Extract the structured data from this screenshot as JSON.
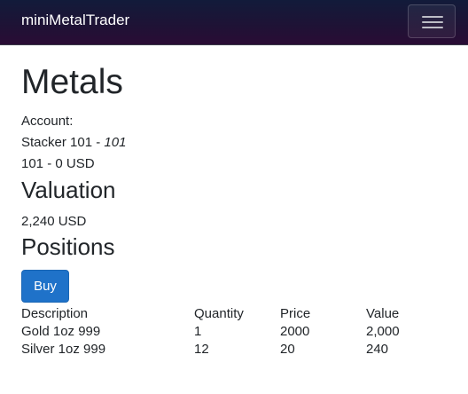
{
  "navbar": {
    "brand": "miniMetalTrader",
    "toggler_icon": "hamburger-menu-icon"
  },
  "page": {
    "title": "Metals"
  },
  "account": {
    "label": "Account:",
    "name": "Stacker 101",
    "separator": " - ",
    "number": "101",
    "balance_line": "101 - 0 USD"
  },
  "valuation": {
    "heading": "Valuation",
    "amount": "2,240 USD"
  },
  "positions": {
    "heading": "Positions",
    "buy_label": "Buy",
    "columns": [
      "Description",
      "Quantity",
      "Price",
      "Value"
    ],
    "rows": [
      {
        "description": "Gold 1oz 999",
        "quantity": "1",
        "price": "2000",
        "value": "2,000"
      },
      {
        "description": "Silver 1oz 999",
        "quantity": "12",
        "price": "20",
        "value": "240"
      }
    ]
  },
  "colors": {
    "navbar": "#1f1235",
    "button": "#1f72c9"
  }
}
